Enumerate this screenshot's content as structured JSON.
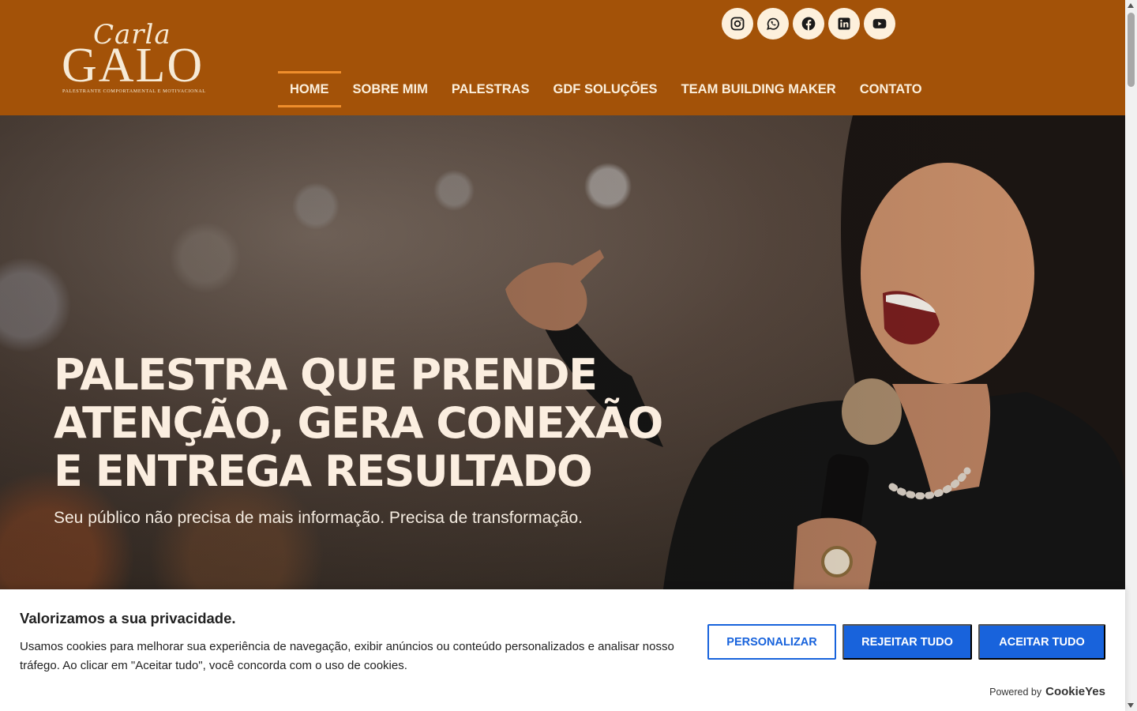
{
  "logo": {
    "script": "Carla",
    "name": "GALO",
    "tagline": "PALESTRANTE COMPORTAMENTAL E MOTIVACIONAL"
  },
  "socials": [
    {
      "icon": "instagram-icon"
    },
    {
      "icon": "whatsapp-icon"
    },
    {
      "icon": "facebook-icon"
    },
    {
      "icon": "linkedin-icon"
    },
    {
      "icon": "youtube-icon"
    }
  ],
  "nav": {
    "items": [
      {
        "label": "HOME",
        "active": true
      },
      {
        "label": "SOBRE MIM"
      },
      {
        "label": "PALESTRAS"
      },
      {
        "label": "GDF SOLUÇÕES"
      },
      {
        "label": "TEAM BUILDING MAKER"
      },
      {
        "label": "CONTATO"
      }
    ]
  },
  "hero": {
    "title": "PALESTRA QUE PRENDE ATENÇÃO, GERA CONEXÃO E ENTREGA RESULTADO",
    "subtitle": "Seu público não precisa de mais informação. Precisa de transformação."
  },
  "cookie": {
    "title": "Valorizamos a sua privacidade.",
    "text": "Usamos cookies para melhorar sua experiência de navegação, exibir anúncios ou conteúdo personalizados e analisar nosso tráfego. Ao clicar em \"Aceitar tudo\", você concorda com o uso de cookies.",
    "customize_label": "PERSONALIZAR",
    "reject_label": "REJEITAR TUDO",
    "accept_label": "ACEITAR TUDO",
    "powered_by": "Powered by",
    "brand": "CookieYes"
  },
  "colors": {
    "header_bg": "#a35208",
    "nav_active_underline": "#ef8e2c",
    "cookie_button": "#1863dc"
  }
}
